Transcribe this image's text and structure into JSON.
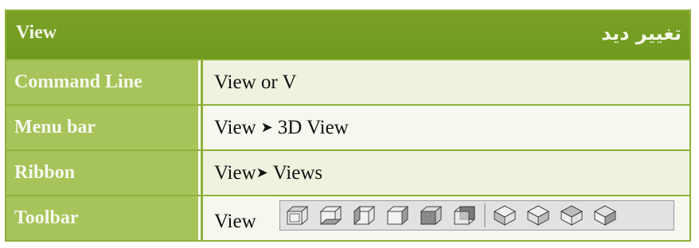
{
  "header": {
    "left": "View",
    "right": "تغییر دید"
  },
  "rows": [
    {
      "label": "Command Line",
      "value": "View or V"
    },
    {
      "label": "Menu bar",
      "value_parts": [
        "View",
        "3D View"
      ]
    },
    {
      "label": "Ribbon",
      "value_parts": [
        "View",
        "Views"
      ]
    },
    {
      "label": "Toolbar",
      "value": "View"
    }
  ],
  "toolbar_icons": [
    "top-view-icon",
    "bottom-view-icon",
    "left-view-icon",
    "right-view-icon",
    "front-view-icon",
    "back-view-icon",
    "sw-isometric-icon",
    "se-isometric-icon",
    "ne-isometric-icon",
    "nw-isometric-icon"
  ]
}
